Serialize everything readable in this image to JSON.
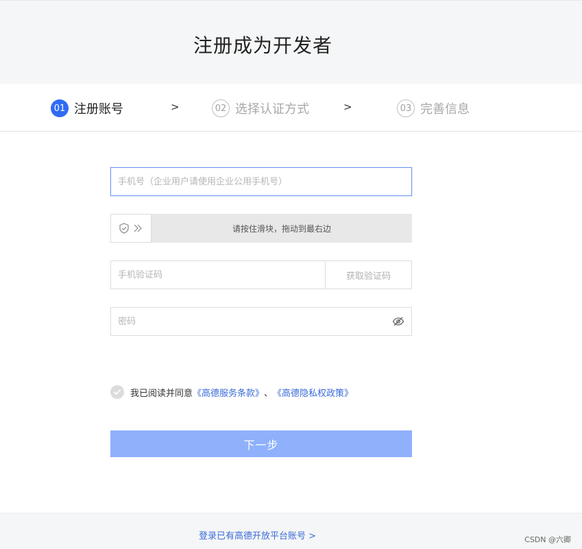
{
  "header": {
    "title": "注册成为开发者"
  },
  "steps": [
    {
      "num": "01",
      "label": "注册账号",
      "state": "active"
    },
    {
      "num": "02",
      "label": "选择认证方式",
      "state": "inactive"
    },
    {
      "num": "03",
      "label": "完善信息",
      "state": "inactive"
    }
  ],
  "step_separator": ">",
  "form": {
    "phone_placeholder": "手机号（企业用户请使用企业公用手机号）",
    "slider_text": "请按住滑块，拖动到最右边",
    "sms_placeholder": "手机验证码",
    "sms_button": "获取验证码",
    "password_placeholder": "密码"
  },
  "agreement": {
    "prefix": "我已阅读并同意",
    "terms_link": "《高德服务条款》",
    "separator": "、",
    "privacy_link": "《高德隐私权政策》"
  },
  "next_button": "下一步",
  "footer": {
    "login_link": "登录已有高德开放平台账号 >",
    "watermark": "CSDN @六卿"
  },
  "colors": {
    "accent": "#2f6bf5",
    "button_disabled": "#8fb1fb",
    "link": "#3a6ad8"
  },
  "icons": {
    "slider": [
      "shield-check-icon",
      "double-chevron-right-icon"
    ],
    "password": "eye-slash-icon",
    "checkbox": "check-icon"
  }
}
